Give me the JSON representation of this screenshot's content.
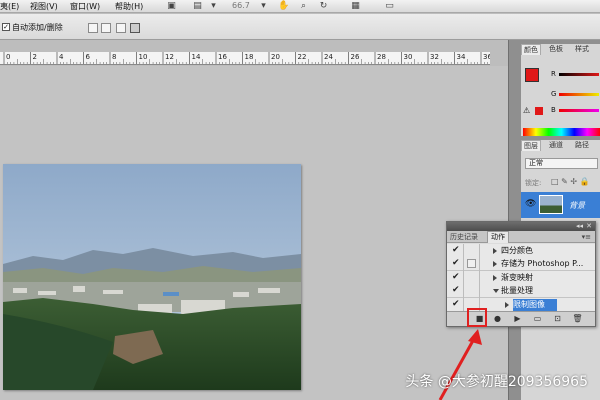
{
  "menubar": {
    "items": [
      "夷(E)",
      "视图(V)",
      "窗口(W)",
      "帮助(H)"
    ],
    "zoom": "66.7",
    "zoom_arrow": "▾"
  },
  "options_bar": {
    "auto_add_delete_label": "自动添加/删除",
    "auto_add_delete_checked": true
  },
  "ruler": {
    "ticks": [
      "0",
      "2",
      "4",
      "6",
      "8",
      "10",
      "12",
      "14",
      "16",
      "18",
      "20",
      "22",
      "24",
      "26",
      "28",
      "30",
      "32",
      "34",
      "36"
    ]
  },
  "color_panel": {
    "tabs": [
      "颜色",
      "色板",
      "样式"
    ],
    "channels": [
      "R",
      "G",
      "B"
    ],
    "foreground_color": "#e01818",
    "background_color": "#000000"
  },
  "layers_panel": {
    "tabs": [
      "图层",
      "通道",
      "路径"
    ],
    "blend_mode": "正常",
    "lock_label": "锁定:",
    "layer_name": "背景"
  },
  "actions_panel": {
    "tabs": [
      "历史记录",
      "动作"
    ],
    "active_tab": "动作",
    "rows": [
      {
        "label": "四分颜色",
        "checked": true,
        "dialog": false,
        "expanded": false,
        "indent": 1,
        "selected": false
      },
      {
        "label": "存储为 Photoshop P...",
        "checked": true,
        "dialog": true,
        "expanded": false,
        "indent": 1,
        "selected": false
      },
      {
        "label": "渐变映射",
        "checked": true,
        "dialog": false,
        "expanded": false,
        "indent": 1,
        "selected": false
      },
      {
        "label": "批量处理",
        "checked": true,
        "dialog": false,
        "expanded": true,
        "indent": 1,
        "selected": false
      },
      {
        "label": "限制图像",
        "checked": true,
        "dialog": false,
        "expanded": false,
        "indent": 2,
        "selected": true
      }
    ],
    "footer_buttons": [
      "stop-icon",
      "record-icon",
      "play-icon",
      "new-set-icon",
      "new-action-icon",
      "delete-icon"
    ]
  },
  "watermark": "头条 @大参初醒209356965",
  "colors": {
    "accent_selected": "#3a7fd5",
    "highlight_red": "#e02020"
  }
}
